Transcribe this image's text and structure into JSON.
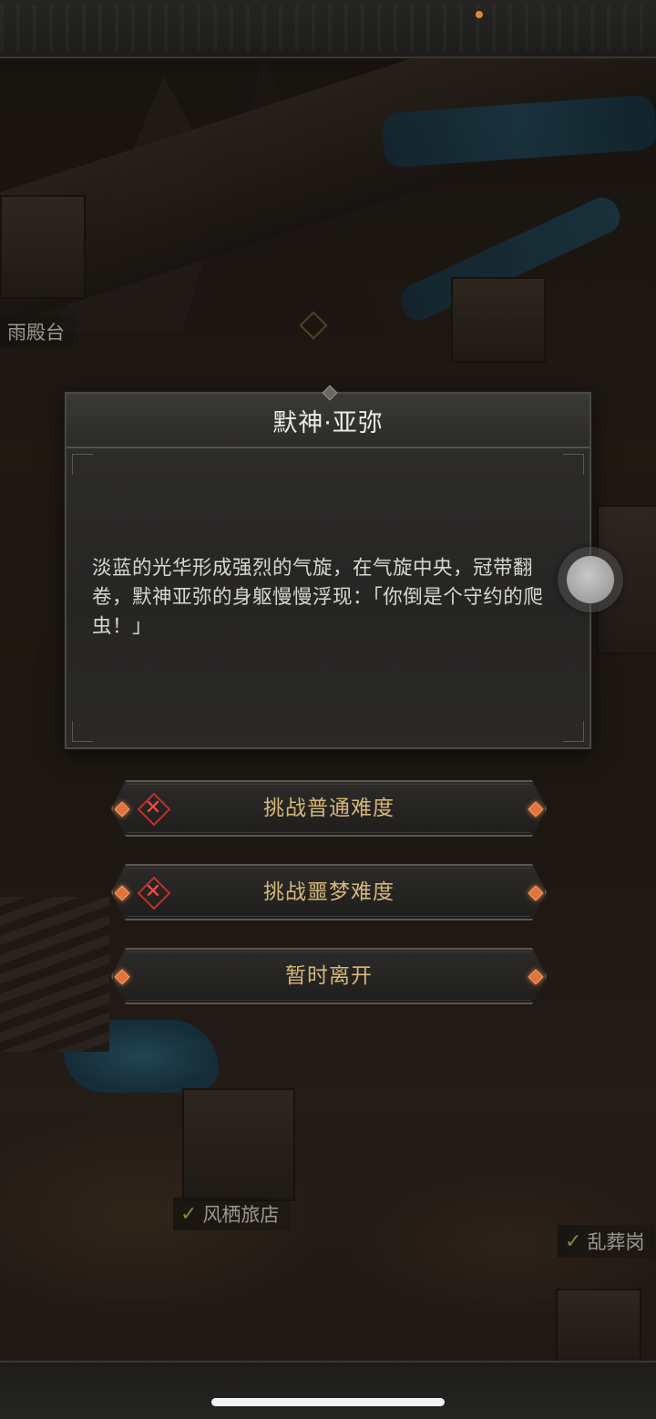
{
  "map": {
    "labels": [
      {
        "text": "雨殿台",
        "checked": false
      },
      {
        "text": "风栖旅店",
        "checked": true
      },
      {
        "text": "乱葬岗",
        "checked": true
      }
    ]
  },
  "dialog": {
    "title": "默神·亚弥",
    "body": "淡蓝的光华形成强烈的气旋，在气旋中央，冠带翻卷，默神亚弥的身躯慢慢浮现：「你倒是个守约的爬虫！」"
  },
  "options": [
    {
      "label": "挑战普通难度",
      "icon": "red-x-icon",
      "locked": true
    },
    {
      "label": "挑战噩梦难度",
      "icon": "red-x-icon",
      "locked": true
    },
    {
      "label": "暂时离开",
      "icon": null,
      "locked": false
    }
  ],
  "colors": {
    "option_text": "#d6b77b",
    "gem": "#e2733a",
    "x_icon": "#ff4a44",
    "status_dot": "#d98a2a"
  }
}
